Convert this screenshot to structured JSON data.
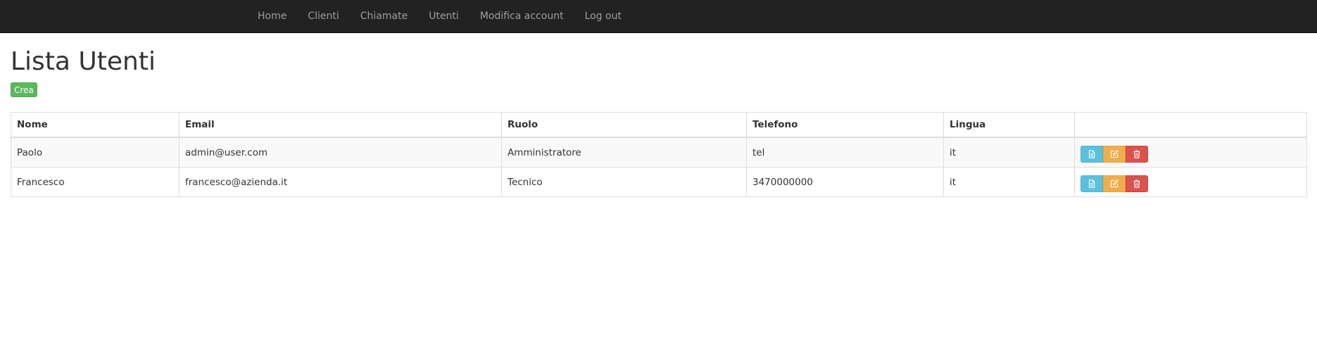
{
  "nav": {
    "items": [
      {
        "label": "Home"
      },
      {
        "label": "Clienti"
      },
      {
        "label": "Chiamate"
      },
      {
        "label": "Utenti"
      },
      {
        "label": "Modifica account"
      },
      {
        "label": "Log out"
      }
    ]
  },
  "page": {
    "title": "Lista Utenti",
    "create_label": "Crea"
  },
  "table": {
    "headers": [
      "Nome",
      "Email",
      "Ruolo",
      "Telefono",
      "Lingua",
      ""
    ],
    "rows": [
      {
        "nome": "Paolo",
        "email": "admin@user.com",
        "ruolo": "Amministratore",
        "telefono": "tel",
        "lingua": "it"
      },
      {
        "nome": "Francesco",
        "email": "francesco@azienda.it",
        "ruolo": "Tecnico",
        "telefono": "3470000000",
        "lingua": "it"
      }
    ],
    "row_actions": [
      {
        "icon": "file-icon",
        "color": "#5bc0de"
      },
      {
        "icon": "edit-icon",
        "color": "#f0ad4e"
      },
      {
        "icon": "trash-icon",
        "color": "#d9534f"
      }
    ]
  },
  "colors": {
    "navbar": "#222222",
    "nav_text": "#9d9d9d",
    "success": "#5cb85c",
    "info": "#5bc0de",
    "warning": "#f0ad4e",
    "danger": "#d9534f"
  }
}
